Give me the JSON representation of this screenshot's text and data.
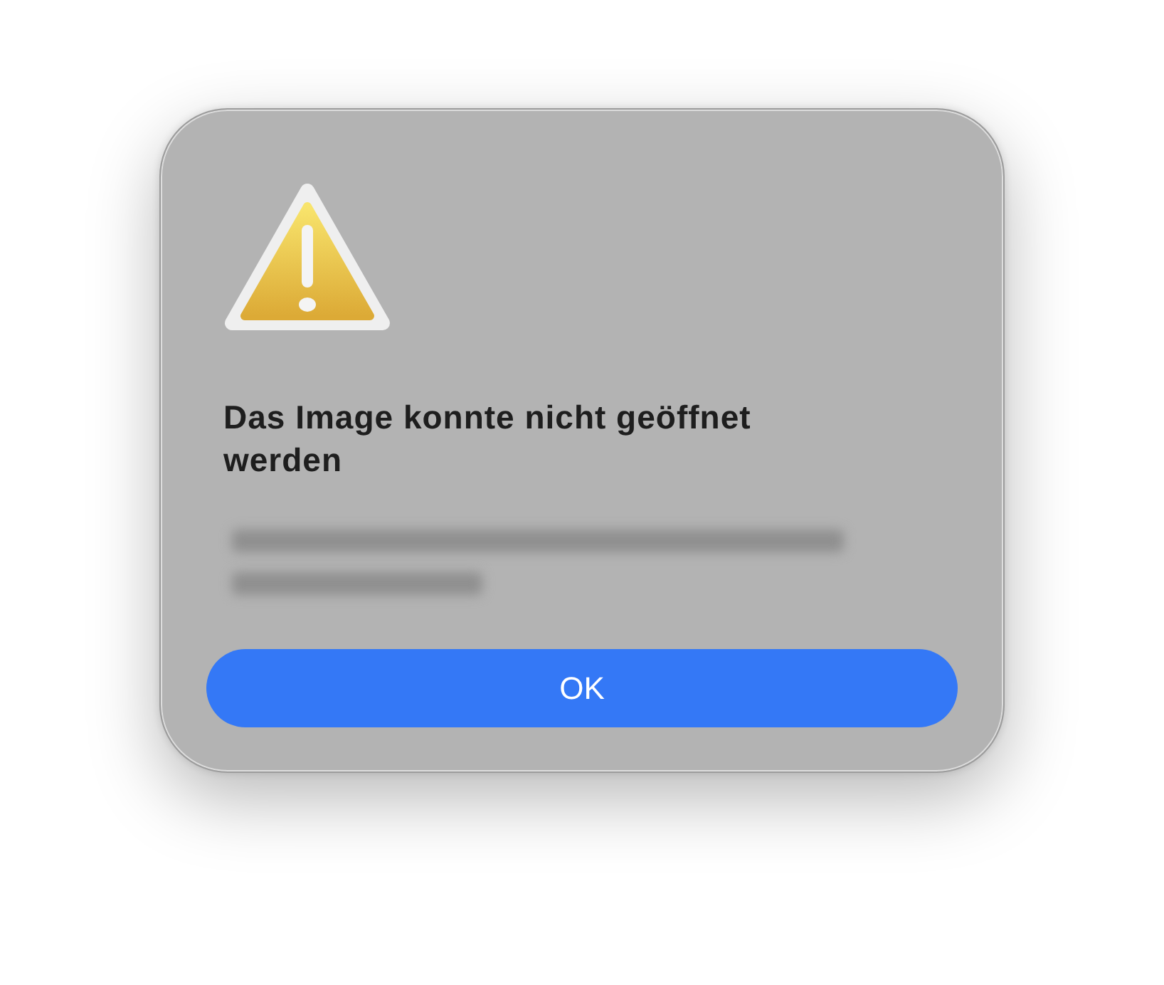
{
  "dialog": {
    "title": "Das Image konnte nicht geöffnet werden",
    "buttons": [
      {
        "label": "OK",
        "default": true
      }
    ]
  }
}
